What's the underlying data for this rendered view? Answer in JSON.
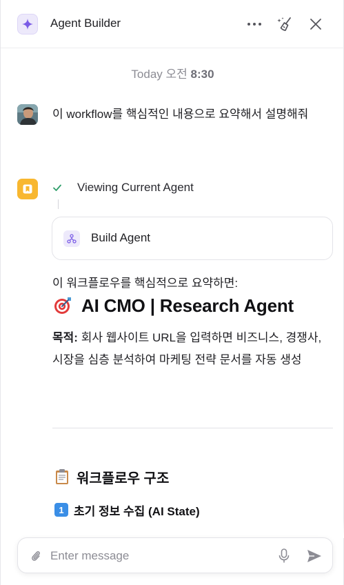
{
  "header": {
    "title": "Agent Builder"
  },
  "chat": {
    "timestamp_day": "Today",
    "timestamp_period": "오전",
    "timestamp_time": "8:30",
    "user_message": "이 workflow를 핵심적인 내용으로 요약해서 설명해줘",
    "step_label": "Viewing Current Agent",
    "tool_card_label": "Build Agent",
    "intro": "이 워크플로우를 핵심적으로 요약하면:",
    "heading": "AI CMO | Research Agent",
    "purpose_label": "목적:",
    "purpose_text": "회사 웹사이트 URL을 입력하면 비즈니스, 경쟁사, 시장을 심층 분석하여 마케팅 전략 문서를 자동 생성",
    "section_heading": "워크플로우 구조",
    "subsection_number": "1",
    "subsection_heading": "초기 정보 수집 (AI State)"
  },
  "composer": {
    "placeholder": "Enter message"
  },
  "icons": {
    "logo": "sparkle-icon",
    "more": "more-horizontal-icon",
    "clear": "broom-sparkle-icon",
    "close": "close-icon",
    "step_status": "check-icon",
    "agent": "bookmark-icon",
    "tool": "workflow-icon",
    "heading_emoji": "target-icon",
    "section_emoji": "clipboard-icon",
    "attach": "paperclip-icon",
    "mic": "microphone-icon",
    "send": "send-icon"
  },
  "colors": {
    "accent": "#7b5ce6",
    "agent_icon_bg": "#f8b730",
    "check": "#2e9e6a",
    "badge_blue": "#3a8ee6"
  }
}
